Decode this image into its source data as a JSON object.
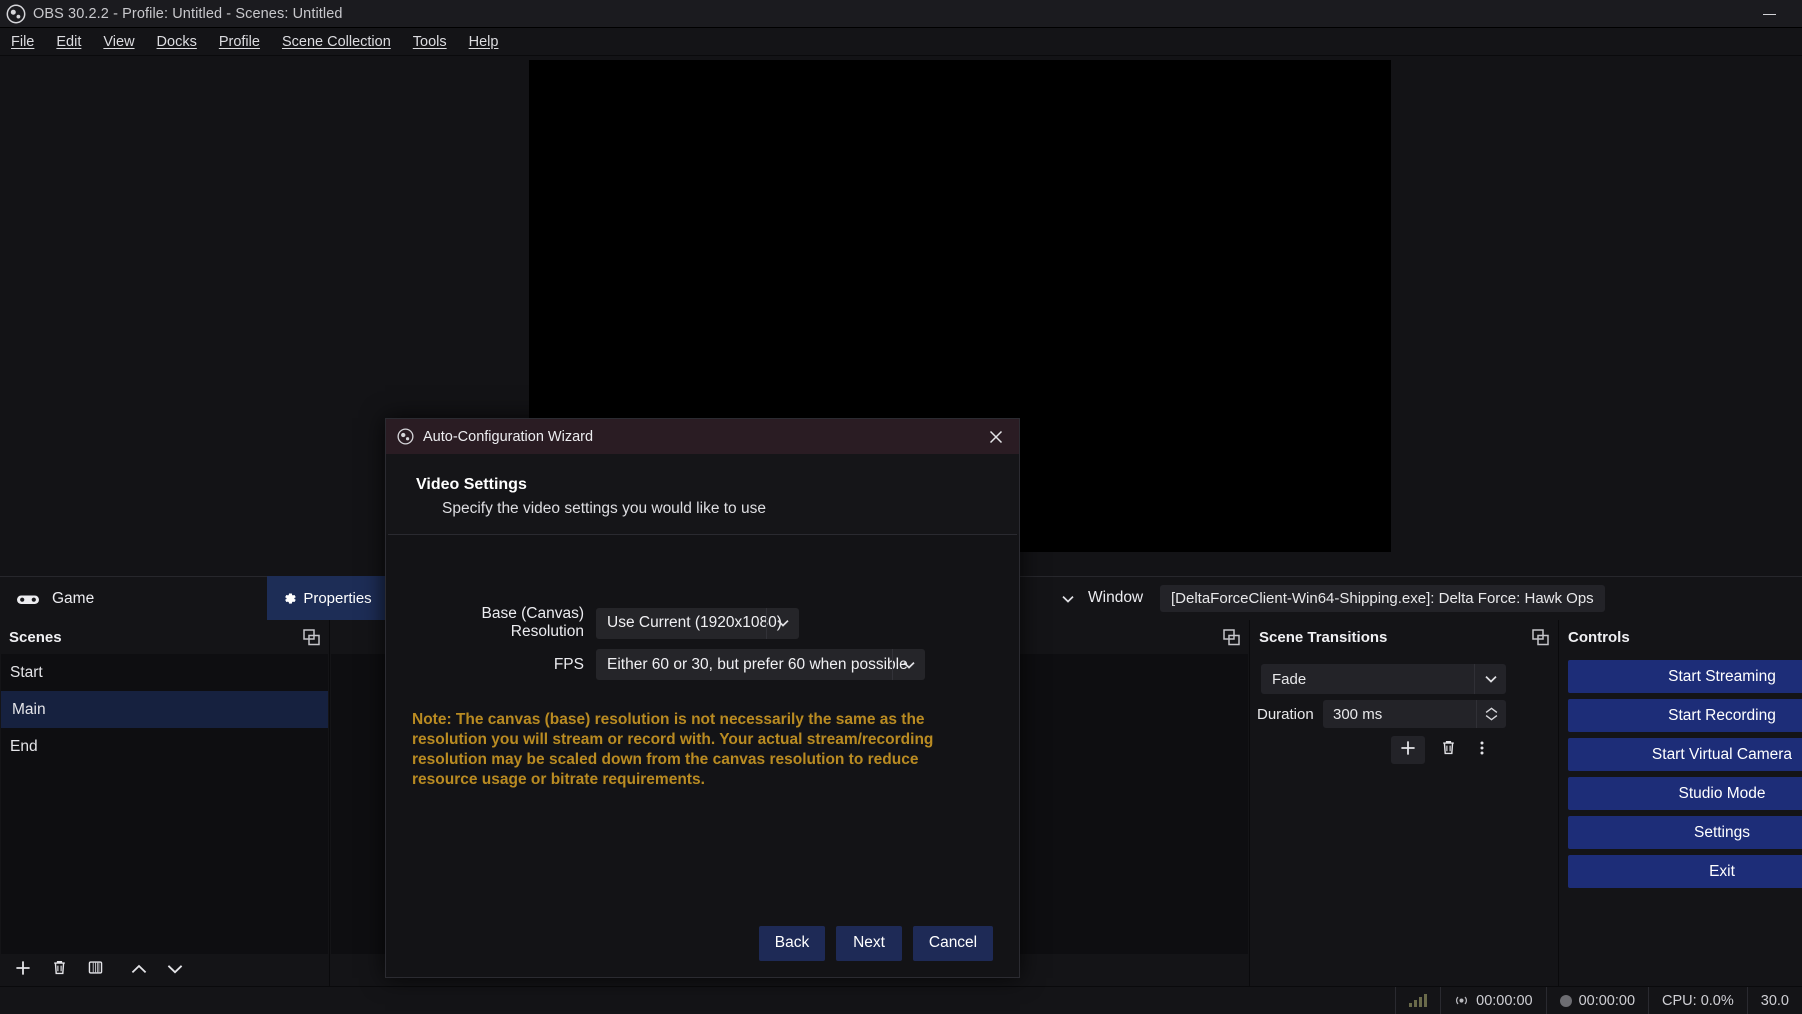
{
  "window": {
    "title": "OBS 30.2.2 - Profile: Untitled - Scenes: Untitled",
    "logo_icon": "obs-logo-icon",
    "minimize_icon": "minimize-icon"
  },
  "menubar": {
    "items": [
      {
        "label": "File",
        "mnemonic": "F"
      },
      {
        "label": "Edit",
        "mnemonic": "E"
      },
      {
        "label": "View",
        "mnemonic": "V"
      },
      {
        "label": "Docks",
        "mnemonic": "D"
      },
      {
        "label": "Profile",
        "mnemonic": "P"
      },
      {
        "label": "Scene Collection",
        "mnemonic": "S"
      },
      {
        "label": "Tools",
        "mnemonic": "T"
      },
      {
        "label": "Help",
        "mnemonic": "H"
      }
    ]
  },
  "source_toolbar": {
    "source_icon": "gamepad-icon",
    "source_label": "Game",
    "properties_label": "Properties",
    "properties_icon": "gear-icon",
    "dropdown_icon": "chevron-down-icon",
    "window_label": "Window",
    "window_value": "[DeltaForceClient-Win64-Shipping.exe]: Delta Force: Hawk Ops"
  },
  "docks": {
    "scenes": {
      "title": "Scenes",
      "float_icon": "float-dock-icon",
      "items": [
        {
          "label": "Start",
          "selected": false
        },
        {
          "label": "Main",
          "selected": true
        },
        {
          "label": "End",
          "selected": false
        }
      ],
      "toolbar": [
        {
          "name": "add-scene-button",
          "icon": "plus-icon"
        },
        {
          "name": "remove-scene-button",
          "icon": "trash-icon"
        },
        {
          "name": "scene-filters-button",
          "icon": "filter-icon"
        },
        {
          "name": "move-scene-up-button",
          "icon": "chevron-up-icon"
        },
        {
          "name": "move-scene-down-button",
          "icon": "chevron-down-icon"
        }
      ]
    },
    "sources": {
      "title": "",
      "float_icon": "float-dock-icon"
    },
    "transitions": {
      "title": "Scene Transitions",
      "float_icon": "float-dock-icon",
      "transition_value": "Fade",
      "dropdown_icon": "chevron-down-icon",
      "duration_label": "Duration",
      "duration_value": "300 ms",
      "spinner_up_icon": "chevron-up-icon",
      "spinner_down_icon": "chevron-down-icon",
      "actions": [
        {
          "name": "add-transition-button",
          "icon": "plus-icon"
        },
        {
          "name": "remove-transition-button",
          "icon": "trash-icon"
        },
        {
          "name": "transition-properties-button",
          "icon": "kebab-menu-icon"
        }
      ]
    },
    "controls": {
      "title": "Controls",
      "float_icon": "float-dock-icon",
      "buttons": [
        {
          "label": "Start Streaming",
          "name": "start-streaming-button"
        },
        {
          "label": "Start Recording",
          "name": "start-recording-button"
        },
        {
          "label": "Start Virtual Camera",
          "name": "start-virtual-camera-button"
        },
        {
          "label": "Studio Mode",
          "name": "studio-mode-button"
        },
        {
          "label": "Settings",
          "name": "settings-button"
        },
        {
          "label": "Exit",
          "name": "exit-button"
        }
      ]
    }
  },
  "statusbar": {
    "signal_icon": "signal-bars-icon",
    "live_icon": "broadcast-icon",
    "live_time": "00:00:00",
    "rec_icon": "record-dot-icon",
    "rec_time": "00:00:00",
    "cpu": "CPU: 0.0%",
    "fps": "30.0"
  },
  "dialog": {
    "title": "Auto-Configuration Wizard",
    "logo_icon": "obs-logo-icon",
    "close_icon": "close-icon",
    "heading": "Video Settings",
    "subheading": "Specify the video settings you would like to use",
    "fields": [
      {
        "label": "Base (Canvas) Resolution",
        "value": "Use Current (1920x1080)",
        "name": "base-canvas-resolution-select"
      },
      {
        "label": "FPS",
        "value": "Either 60 or 30, but prefer 60 when possible",
        "name": "fps-select"
      }
    ],
    "note": "Note: The canvas (base) resolution is not necessarily the same as the resolution you will stream or record with. Your actual stream/recording resolution may be scaled down from the canvas resolution to reduce resource usage or bitrate requirements.",
    "note_color": "#b98b22",
    "buttons": [
      {
        "label": "Back",
        "name": "back-button"
      },
      {
        "label": "Next",
        "name": "next-button"
      },
      {
        "label": "Cancel",
        "name": "cancel-button"
      }
    ]
  },
  "colors": {
    "accent_blue": "#1d2d78",
    "dialog_title_bg": "#2a1c23",
    "selection_blue": "#16213f",
    "note_amber": "#b98b22"
  }
}
